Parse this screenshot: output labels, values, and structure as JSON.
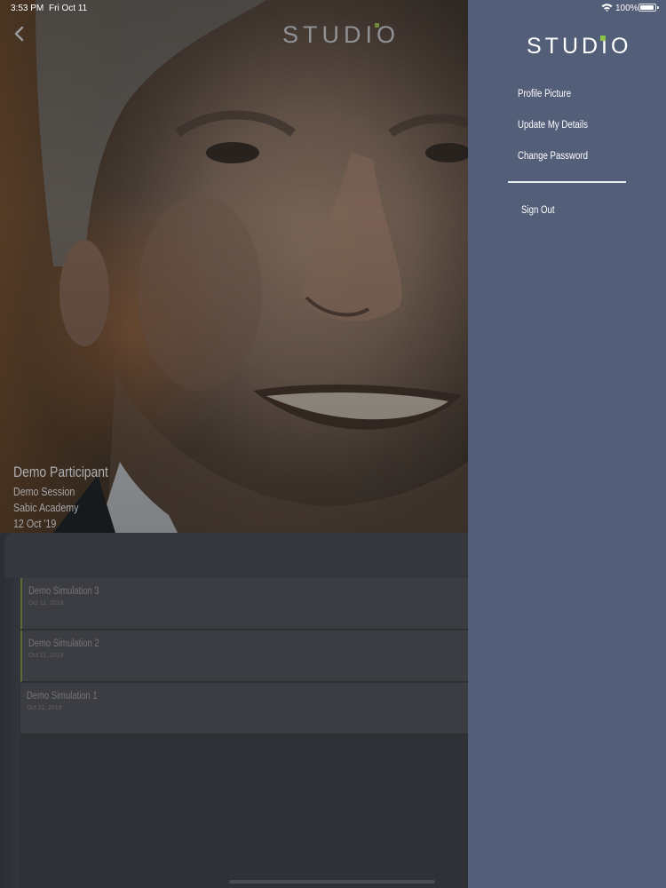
{
  "status_bar": {
    "time": "3:53 PM",
    "date": "Fri Oct 11",
    "battery": "100%",
    "icons": [
      "wifi-icon",
      "battery-icon"
    ]
  },
  "app": {
    "logo": "STUDIO",
    "back_icon": "chevron-left-icon",
    "profile": {
      "name": "Demo Participant",
      "session": "Demo Session",
      "academy": "Sabic Academy",
      "date": "12 Oct '19"
    },
    "simulations": [
      {
        "title": "Demo Simulation 3",
        "date": "Oct 11, 2019"
      },
      {
        "title": "Demo Simulation 2",
        "date": "Oct 11, 2019"
      },
      {
        "title": "Demo Simulation 1",
        "date": "Oct 11, 2019"
      }
    ]
  },
  "side_menu": {
    "logo": "STUDIO",
    "items": [
      {
        "label": "Profile Picture"
      },
      {
        "label": "Update My Details"
      },
      {
        "label": "Change Password"
      }
    ],
    "sign_out": "Sign Out"
  },
  "colors": {
    "menu_bg": "#535e78",
    "accent": "#8cc34a",
    "overlay_bg": "#2e2f34"
  }
}
